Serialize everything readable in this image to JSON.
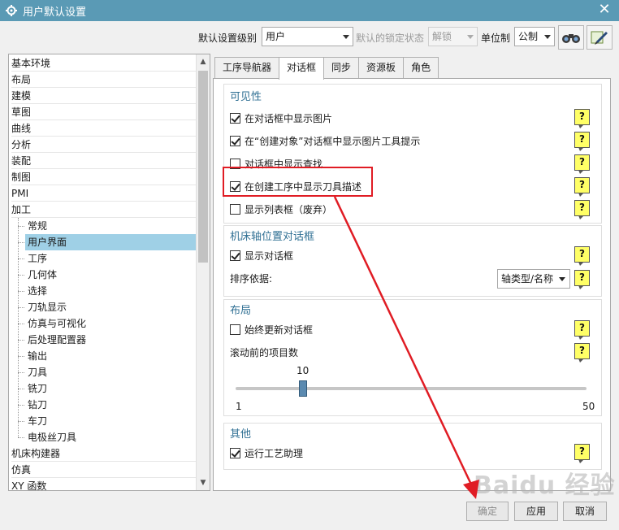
{
  "window": {
    "title": "用户默认设置",
    "close_glyph": "✕"
  },
  "toolbar": {
    "level_label": "默认设置级别",
    "level_value": "用户",
    "lock_label": "默认的锁定状态",
    "lock_value": "解锁",
    "unit_label": "单位制",
    "unit_value": "公制"
  },
  "tree": {
    "items": [
      "基本环境",
      "布局",
      "建模",
      "草图",
      "曲线",
      "分析",
      "装配",
      "制图",
      "PMI",
      "加工",
      "常规",
      "用户界面",
      "工序",
      "几何体",
      "选择",
      "刀轨显示",
      "仿真与可视化",
      "后处理配置器",
      "输出",
      "刀具",
      "铣刀",
      "钻刀",
      "车刀",
      "电极丝刀具",
      "机床构建器",
      "仿真",
      "XY 函数"
    ]
  },
  "tabs": [
    "工序导航器",
    "对话框",
    "同步",
    "资源板",
    "角色"
  ],
  "sections": {
    "visibility": {
      "title": "可见性",
      "items": [
        "在对话框中显示图片",
        "在“创建对象”对话框中显示图片工具提示",
        "对话框中显示查找",
        "在创建工序中显示刀具描述",
        "显示列表框（废弃）"
      ]
    },
    "mct": {
      "title": "机床轴位置对话框",
      "show_dialog": "显示对话框",
      "sort_label": "排序依据:",
      "sort_value": "轴类型/名称"
    },
    "layout": {
      "title": "布局",
      "always_update": "始终更新对话框",
      "scroll_label": "滚动前的项目数",
      "slider_value": "10",
      "slider_min": "1",
      "slider_max": "50"
    },
    "other": {
      "title": "其他",
      "run_assistant": "运行工艺助理"
    }
  },
  "help_glyph": "?",
  "buttons": {
    "ok": "确定",
    "apply": "应用",
    "cancel": "取消"
  },
  "watermark": "Baidu 经验",
  "colors": {
    "titlebar": "#5a9ab5",
    "selected": "#9fd0e6",
    "highlight": "#e01c24",
    "help": "#ffff66"
  }
}
